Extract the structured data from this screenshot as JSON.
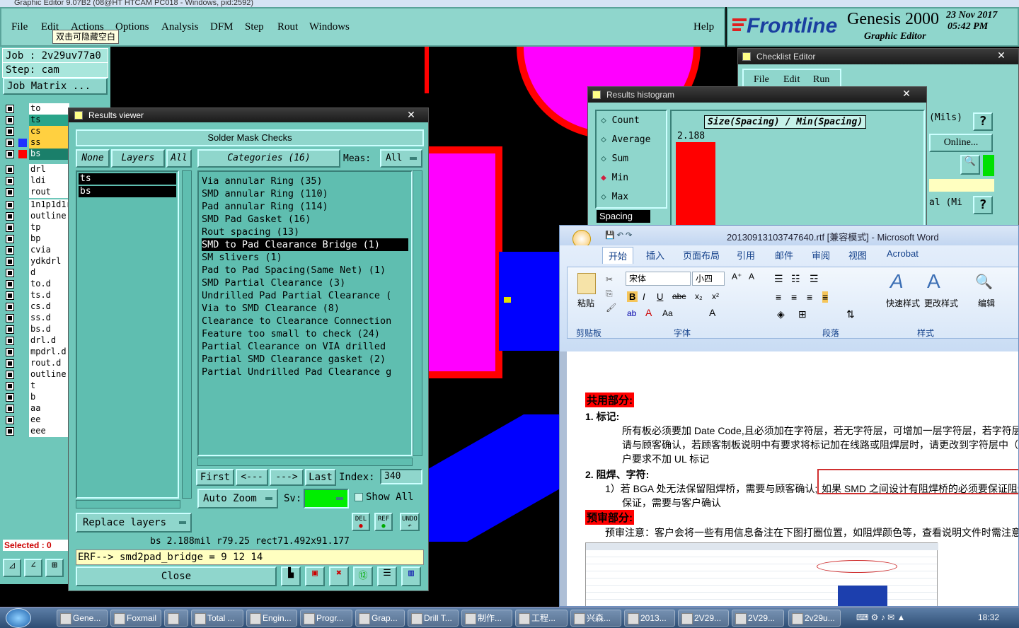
{
  "window_title": "Graphic Editor 9.07B2 (08@HT HTCAM PC018 - Windows, pid:2592)",
  "menu": {
    "file": "File",
    "edit": "Edit",
    "actions": "Actions",
    "options": "Options",
    "analysis": "Analysis",
    "dfm": "DFM",
    "step": "Step",
    "rout": "Rout",
    "windows": "Windows",
    "help": "Help"
  },
  "tooltip": "双击可隐藏空白",
  "logo": {
    "brand": "Frontline",
    "product": "Genesis 2000",
    "subtitle": "Graphic Editor",
    "date": "23 Nov 2017",
    "time": "05:42 PM"
  },
  "left": {
    "job": "Job : 2v29uv77a0",
    "step": "Step: cam",
    "job_matrix": "Job Matrix ...",
    "selected": "Selected : 0"
  },
  "layers": [
    {
      "name": "to",
      "color": "#ffffff"
    },
    {
      "name": "ts",
      "color": "#2aa58a"
    },
    {
      "name": "cs",
      "color": "#ffd040"
    },
    {
      "name": "ss",
      "color": "#ffd040"
    },
    {
      "name": "bs",
      "color": "#1a7f6a"
    },
    {
      "name": "drl",
      "color": ""
    },
    {
      "name": "ldi",
      "color": ""
    },
    {
      "name": "rout",
      "color": ""
    },
    {
      "name": "1n1p1d1r",
      "color": ""
    },
    {
      "name": "outline",
      "color": ""
    },
    {
      "name": "tp",
      "color": ""
    },
    {
      "name": "bp",
      "color": ""
    },
    {
      "name": "cvia",
      "color": ""
    },
    {
      "name": "ydkdrl",
      "color": ""
    },
    {
      "name": "d",
      "color": ""
    },
    {
      "name": "to.d",
      "color": ""
    },
    {
      "name": "ts.d",
      "color": ""
    },
    {
      "name": "cs.d",
      "color": ""
    },
    {
      "name": "ss.d",
      "color": ""
    },
    {
      "name": "bs.d",
      "color": ""
    },
    {
      "name": "drl.d",
      "color": ""
    },
    {
      "name": "mpdrl.d",
      "color": ""
    },
    {
      "name": "rout.d",
      "color": ""
    },
    {
      "name": "outline.",
      "color": ""
    },
    {
      "name": "t",
      "color": ""
    },
    {
      "name": "b",
      "color": ""
    },
    {
      "name": "aa",
      "color": ""
    },
    {
      "name": "ee",
      "color": ""
    },
    {
      "name": "eee",
      "color": ""
    }
  ],
  "results_viewer": {
    "title": "Results viewer",
    "header": "Solder Mask Checks",
    "none": "None",
    "layers": "Layers",
    "all": "All",
    "categories_label": "Categories (16)",
    "meas_label": "Meas:",
    "meas_value": "All",
    "layer_items": [
      "ts",
      "bs"
    ],
    "categories": [
      "Via annular Ring (35)",
      "SMD annular Ring (110)",
      "Pad annular Ring (114)",
      "SMD Pad Gasket (16)",
      "Rout spacing (13)",
      "SMD to Pad Clearance Bridge (1)",
      "SM slivers (1)",
      "Pad to Pad Spacing(Same Net) (1)",
      "SMD Partial Clearance (3)",
      "Undrilled Pad Partial Clearance (",
      "Via to SMD Clearance (8)",
      "Clearance to Clearance Connection",
      "Feature too small to check (24)",
      "Partial Clearance on VIA drilled",
      "Partial SMD Clearance gasket (2)",
      "Partial Undrilled Pad Clearance g"
    ],
    "selected_category": 5,
    "first": "First",
    "prev": "<---",
    "next": "--->",
    "last": "Last",
    "index_label": "Index:",
    "index_value": "340",
    "auto_zoom": "Auto Zoom",
    "sv": "Sv:",
    "show_all": "Show All",
    "replace_layers": "Replace layers",
    "del": "DEL",
    "ref": "REF",
    "undo": "UNDO",
    "status": "bs 2.188mil   r79.25  rect71.492x91.177",
    "erf": "ERF--> smd2pad_bridge = 9 12 14",
    "close": "Close"
  },
  "histogram": {
    "title": "Results histogram",
    "options": [
      "Count",
      "Average",
      "Sum",
      "Min",
      "Max"
    ],
    "selected_option": "Min",
    "field": "Spacing",
    "chart_title": "Size(Spacing) / Min(Spacing)",
    "value_label": "2.188"
  },
  "checklist": {
    "title": "Checklist Editor",
    "file": "File",
    "edit": "Edit",
    "run": "Run",
    "mils": "(Mils)",
    "online": "Online...",
    "al": "al (Mi",
    "q": "?"
  },
  "word": {
    "title": "20130913103747640.rtf [兼容模式] - Microsoft Word",
    "tabs": [
      "开始",
      "插入",
      "页面布局",
      "引用",
      "邮件",
      "审阅",
      "视图",
      "Acrobat"
    ],
    "font": "宋体",
    "size": "小四",
    "groups": [
      "剪贴板",
      "字体",
      "段落",
      "样式",
      "编辑"
    ],
    "paste": "粘贴",
    "quick_styles": "快速样式",
    "change_styles": "更改样式",
    "edit_label": "编辑",
    "h1": "共用部分:",
    "item1": "1.   标记:",
    "p1a": "所有板必须要加 Date Code,且必须加在字符层，若无字符层，可增加一层字符层，若字符层",
    "p1b": "请与顾客确认，若顾客制板说明中有要求将标记加在线路或阻焊层时，请更改到字符层中（无",
    "p1c": "户要求不加 UL 标记",
    "item2": "2.   阻焊、字符:",
    "p2a": "1）若 BGA 处无法保留阻焊桥，需要与顾客确认;",
    "p2b": "如果 SMD 之间设计有阻焊桥的必须要保证阻焊",
    "p2c": "保证，需要与客户确认",
    "h2": "预审部分:",
    "p3": "预审注意：客户会将一些有用信息备注在下图打圈位置，如阻焊颜色等，查看说明文件时需注意"
  },
  "taskbar": {
    "items": [
      "Gene...",
      "Foxmail",
      "",
      "Total ...",
      "Engin...",
      "Progr...",
      "Grap...",
      "Drill T...",
      "制作...",
      "工程...",
      "兴森...",
      "2013...",
      "2V29...",
      "2V29...",
      "2v29u..."
    ],
    "time": "18:32"
  }
}
